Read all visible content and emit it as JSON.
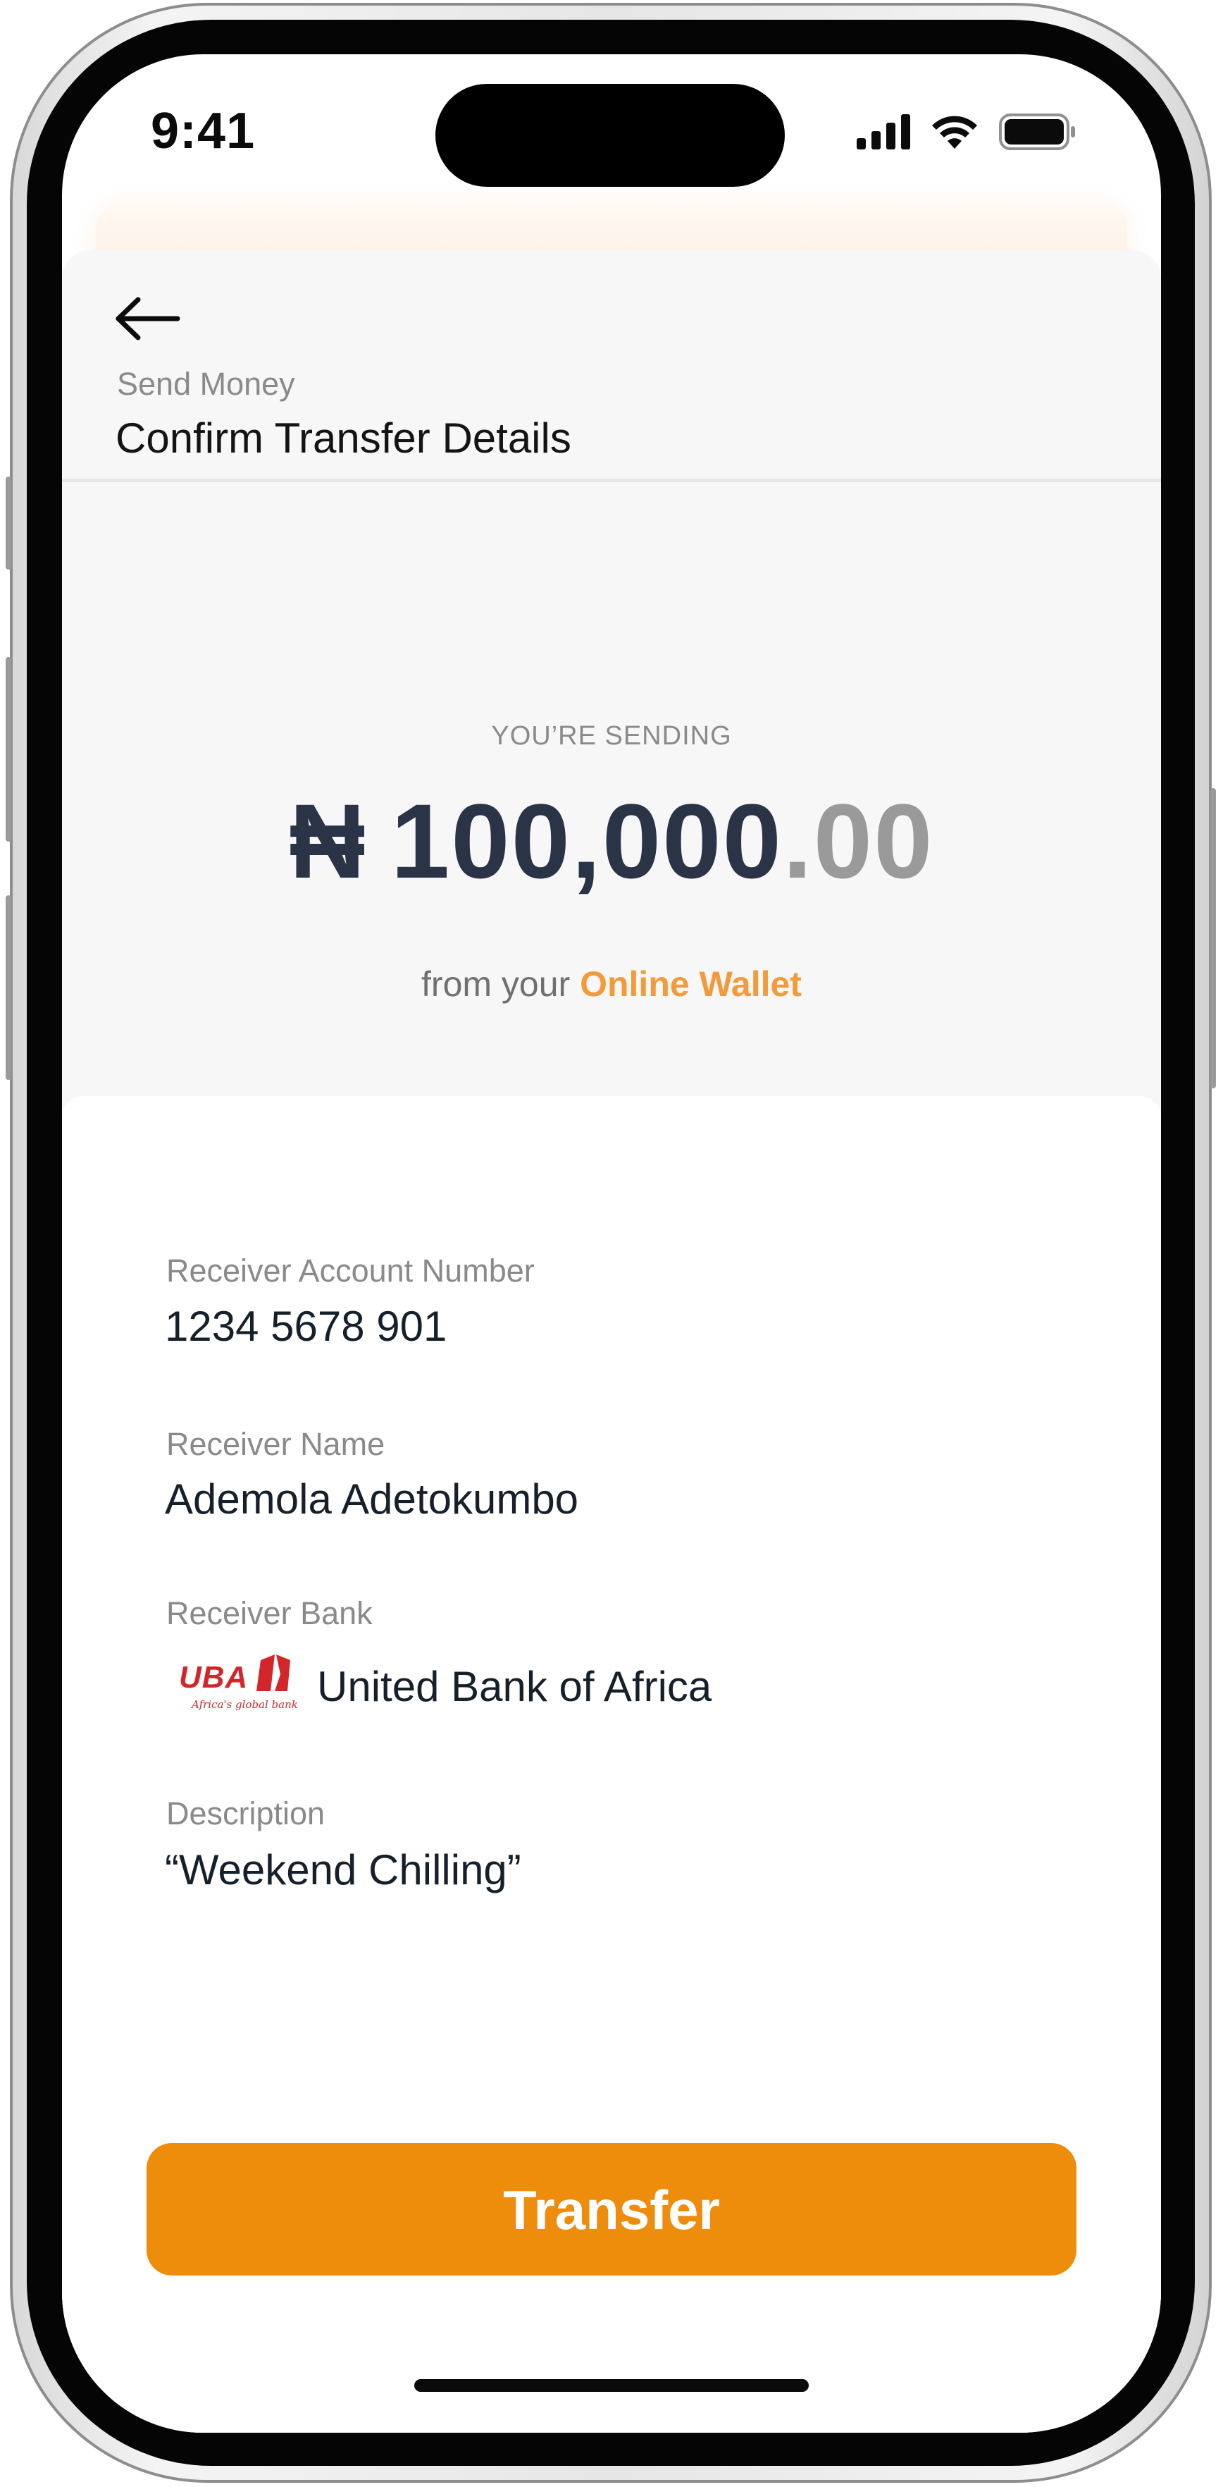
{
  "status_bar": {
    "time": "9:41",
    "icons": [
      "cellular-signal-icon",
      "wifi-icon",
      "battery-icon"
    ]
  },
  "header": {
    "back_icon": "arrow-left-icon",
    "breadcrumb": "Send Money",
    "title": "Confirm Transfer Details"
  },
  "amount": {
    "label": "YOU’RE SENDING",
    "currency_symbol": "₦",
    "whole": "100,000",
    "decimal": ".00",
    "source_prefix": "from your",
    "source": "Online Wallet"
  },
  "details": {
    "account_number": {
      "label": "Receiver Account Number",
      "value": "1234 5678 901"
    },
    "receiver_name": {
      "label": "Receiver Name",
      "value": "Ademola Adetokumbo"
    },
    "receiver_bank": {
      "label": "Receiver Bank",
      "logo_text": "UBA",
      "logo_tagline": "Africa's global bank",
      "value": "United Bank of Africa"
    },
    "description": {
      "label": "Description",
      "value": "“Weekend Chilling”"
    }
  },
  "actions": {
    "transfer_label": "Transfer"
  },
  "colors": {
    "accent": "#ee8c0c",
    "wallet_link": "#f39a3b",
    "amount": "#2b3446",
    "bank_brand": "#d3262a"
  }
}
